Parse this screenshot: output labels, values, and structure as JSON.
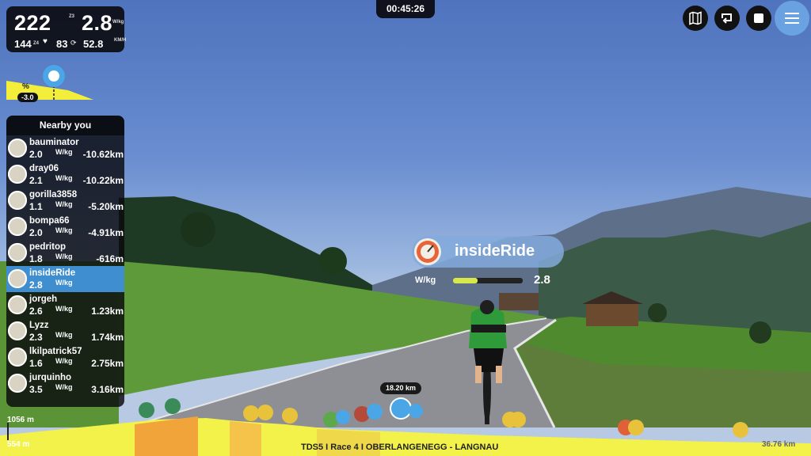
{
  "stats": {
    "power": "222",
    "power_zone": "Z3",
    "wkg": "2.8",
    "wkg_unit": "W/kg",
    "heart_rate": "144",
    "hr_zone": "Z4",
    "cadence": "83",
    "speed": "52.8",
    "speed_unit": "KM/H"
  },
  "timer": "00:45:26",
  "gradient": {
    "label": "%",
    "value": "-3.0"
  },
  "nearby": {
    "title": "Nearby you",
    "riders": [
      {
        "name": "bauminator",
        "wkg": "2.0",
        "dist": "-10.62km",
        "me": false
      },
      {
        "name": "dray06",
        "wkg": "2.1",
        "dist": "-10.22km",
        "me": false
      },
      {
        "name": "gorilla3858",
        "wkg": "1.1",
        "dist": "-5.20km",
        "me": false
      },
      {
        "name": "bompa66",
        "wkg": "2.0",
        "dist": "-4.91km",
        "me": false
      },
      {
        "name": "pedritop",
        "wkg": "1.8",
        "dist": "-616m",
        "me": false
      },
      {
        "name": "insideRide",
        "wkg": "2.8",
        "dist": "",
        "me": true
      },
      {
        "name": "jorgeh",
        "wkg": "2.6",
        "dist": "1.23km",
        "me": false
      },
      {
        "name": "Lyzz",
        "wkg": "2.3",
        "dist": "1.74km",
        "me": false
      },
      {
        "name": "lkilpatrick57",
        "wkg": "1.6",
        "dist": "2.75km",
        "me": false
      },
      {
        "name": "jurquinho",
        "wkg": "3.5",
        "dist": "3.16km",
        "me": false
      }
    ],
    "wkg_unit": "W/kg"
  },
  "player": {
    "name": "insideRide",
    "wkg_label": "W/kg",
    "wkg": "2.8",
    "wkg_fraction": 0.35
  },
  "position_badge": "18.20 km",
  "elevation": {
    "max": "1056 m",
    "min": "554 m",
    "total": "36.76 km"
  },
  "route_name": "TDS5 I Race 4 I OBERLANGENEGG - LANGNAU",
  "colors": {
    "accent": "#3f8fd0",
    "profile_yellow": "#f2f24a",
    "profile_orange": "#f0a43a"
  },
  "toolbar": {
    "icons": [
      "map-icon",
      "loop-icon",
      "stop-icon",
      "menu-icon"
    ]
  }
}
